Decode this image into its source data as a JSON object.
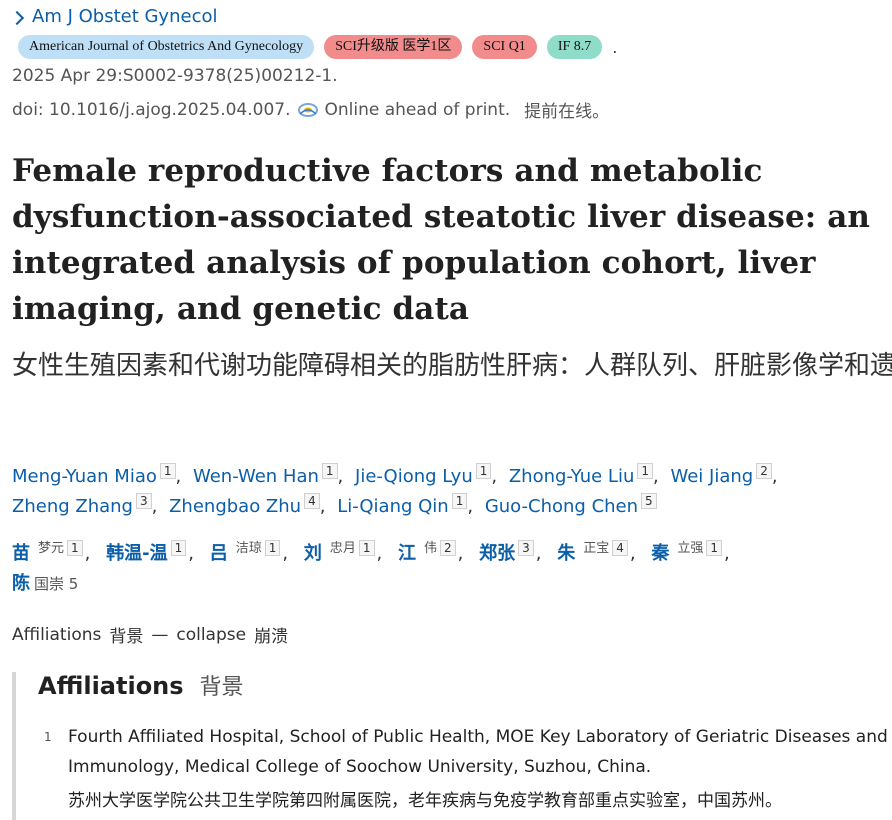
{
  "journal": {
    "name": "Am J Obstet Gynecol"
  },
  "badges": [
    {
      "label": "American Journal of Obstetrics And Gynecology",
      "color": "#bfdff6"
    },
    {
      "label": "SCI升级版 医学1区",
      "color": "#f28b8b"
    },
    {
      "label": "SCI Q1",
      "color": "#f28b8b"
    },
    {
      "label": "IF 8.7",
      "color": "#8fdcc9"
    }
  ],
  "badge_trailer": ".",
  "citation": "2025 Apr 29:S0002-9378(25)00212-1.",
  "doi": {
    "text": "doi: 10.1016/j.ajog.2025.04.007.",
    "icon": "full-text-link-icon",
    "status": "Online ahead of print.",
    "status_zh": "提前在线。"
  },
  "title": "Female reproductive factors and metabolic dysfunction-associated steatotic liver disease: an integrated analysis of population cohort, liver imaging, and genetic data",
  "title_zh": "女性生殖因素和代谢功能障碍相关的脂肪性肝病：人群队列、肝脏影像学和遗传数据的综合分析",
  "authors": [
    {
      "name": "Meng-Yuan Miao",
      "aff": "1"
    },
    {
      "name": "Wen-Wen Han",
      "aff": "1"
    },
    {
      "name": "Jie-Qiong Lyu",
      "aff": "1"
    },
    {
      "name": "Zhong-Yue Liu",
      "aff": "1"
    },
    {
      "name": "Wei Jiang",
      "aff": "2"
    },
    {
      "name": "Zheng Zhang",
      "aff": "3"
    },
    {
      "name": "Zhengbao Zhu",
      "aff": "4"
    },
    {
      "name": "Li-Qiang Qin",
      "aff": "1"
    },
    {
      "name": "Guo-Chong Chen",
      "aff": "5"
    }
  ],
  "authors_zh": [
    {
      "first": "苗",
      "rest": "梦元",
      "aff": "1"
    },
    {
      "first": "韩温-温",
      "rest": "",
      "aff": "1"
    },
    {
      "first": "吕",
      "rest": "洁琼",
      "aff": "1"
    },
    {
      "first": "刘",
      "rest": "忠月",
      "aff": "1"
    },
    {
      "first": "江",
      "rest": "伟",
      "aff": "2"
    },
    {
      "first": "郑张",
      "rest": "",
      "aff": "3"
    },
    {
      "first": "朱",
      "rest": "正宝",
      "aff": "4"
    },
    {
      "first": "秦",
      "rest": "立强",
      "aff": "1"
    },
    {
      "first": "陈",
      "rest": "",
      "plain": "国崇 5"
    }
  ],
  "affiliations_toggle": {
    "label": "Affiliations",
    "label_zh": "背景",
    "dash": "—",
    "action": "collapse",
    "action_zh": "崩溃"
  },
  "affiliations_section": {
    "heading": "Affiliations",
    "heading_zh": "背景",
    "items": [
      {
        "num": "1",
        "text": "Fourth Affiliated Hospital, School of Public Health, MOE Key Laboratory of Geriatric Diseases and Immunology, Medical College of Soochow University, Suzhou, China.",
        "text_zh": "苏州大学医学院公共卫生学院第四附属医院，老年疾病与免疫学教育部重点实验室，中国苏州。"
      }
    ]
  }
}
